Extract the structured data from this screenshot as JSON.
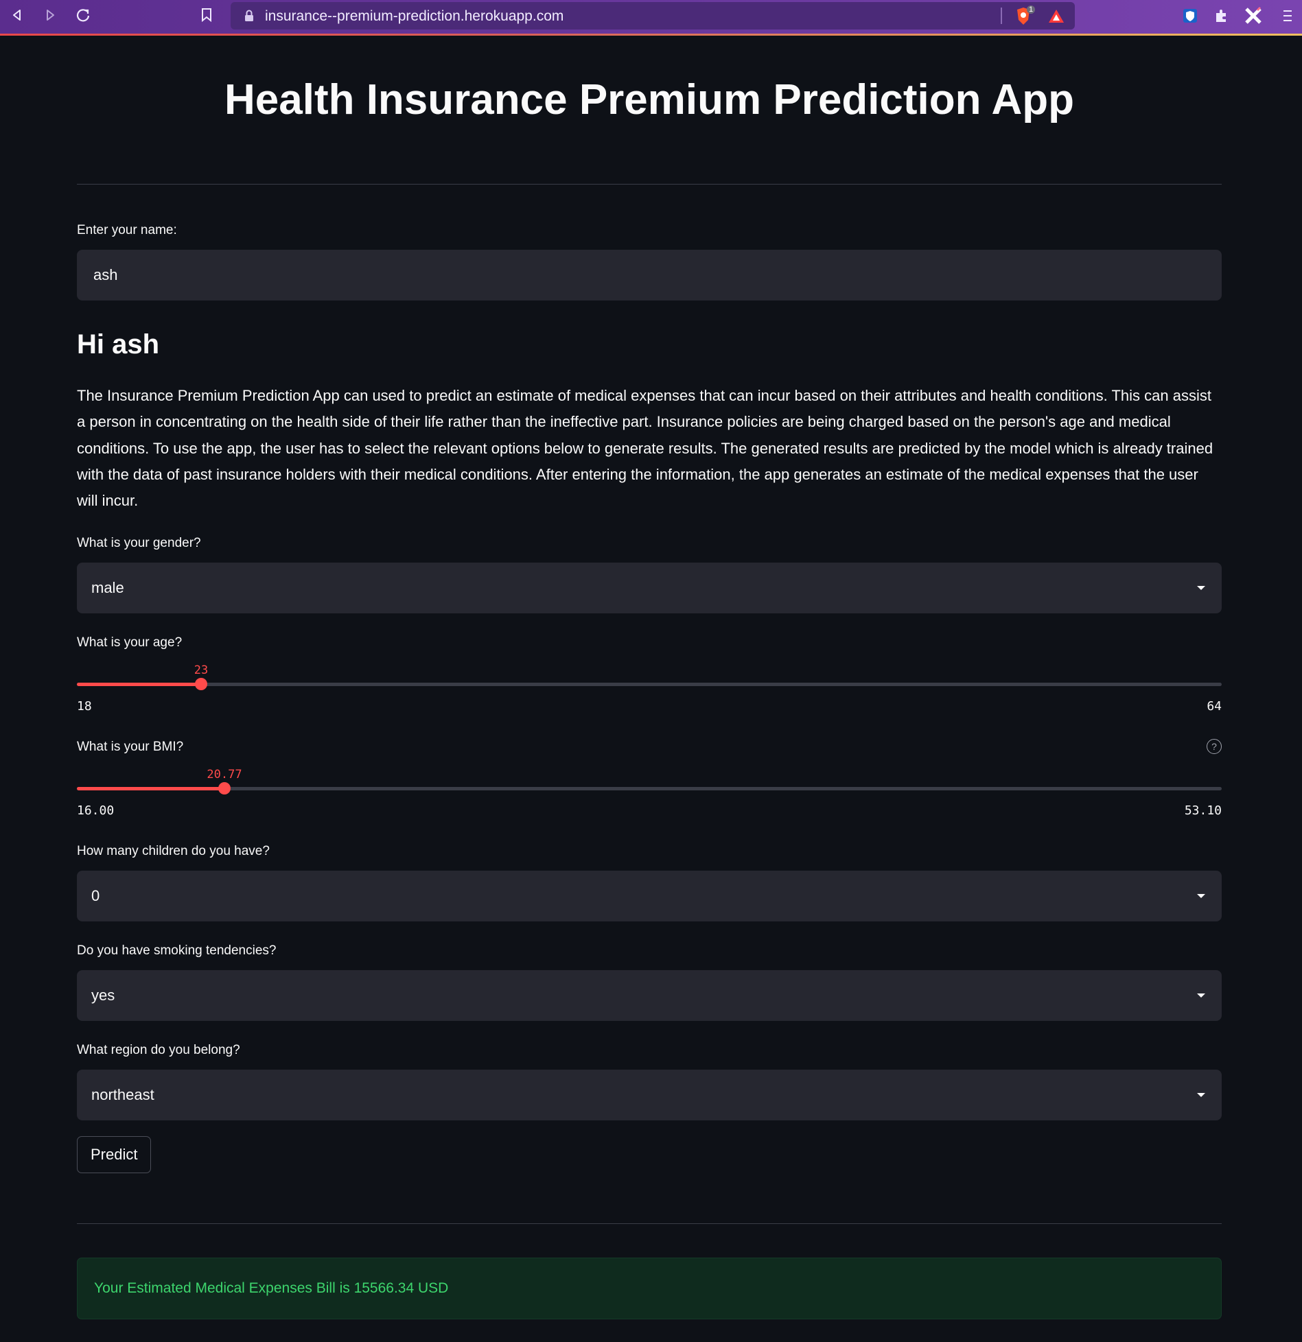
{
  "browser": {
    "url": "insurance--premium-prediction.herokuapp.com",
    "brave_badge": "1"
  },
  "app": {
    "title": "Health Insurance Premium Prediction App",
    "name_label": "Enter your name:",
    "name_value": "ash",
    "greeting": "Hi ash",
    "description": "The Insurance Premium Prediction App can used to predict an estimate of medical expenses that can incur based on their attributes and health conditions. This can assist a person in concentrating on the health side of their life rather than the ineffective part. Insurance policies are being charged based on the person's age and medical conditions. To use the app, the user has to select the relevant options below to generate results. The generated results are predicted by the model which is already trained with the data of past insurance holders with their medical conditions. After entering the information, the app generates an estimate of the medical expenses that the user will incur.",
    "gender": {
      "label": "What is your gender?",
      "value": "male"
    },
    "age": {
      "label": "What is your age?",
      "value": "23",
      "min": "18",
      "max": "64"
    },
    "bmi": {
      "label": "What is your BMI?",
      "value": "20.77",
      "min": "16.00",
      "max": "53.10"
    },
    "children": {
      "label": "How many children do you have?",
      "value": "0"
    },
    "smoker": {
      "label": "Do you have smoking tendencies?",
      "value": "yes"
    },
    "region": {
      "label": "What region do you belong?",
      "value": "northeast"
    },
    "predict_label": "Predict",
    "result": "Your Estimated Medical Expenses Bill is 15566.34 USD"
  },
  "colors": {
    "background": "#0e1117",
    "accent": "#ff4b4b",
    "input_bg": "#262730",
    "success_text": "#3dd56d",
    "success_bg": "#0f2b1e",
    "browser_purple": "#5b2d8e"
  },
  "icons": {
    "back": "back-arrow-icon",
    "forward": "forward-arrow-icon",
    "reload": "reload-icon",
    "bookmark": "bookmark-icon",
    "lock": "lock-icon",
    "brave": "brave-shield-icon",
    "rewards": "brave-rewards-icon",
    "extensions": "puzzle-icon",
    "menu": "hamburger-menu-icon",
    "help": "question-circle-icon"
  }
}
